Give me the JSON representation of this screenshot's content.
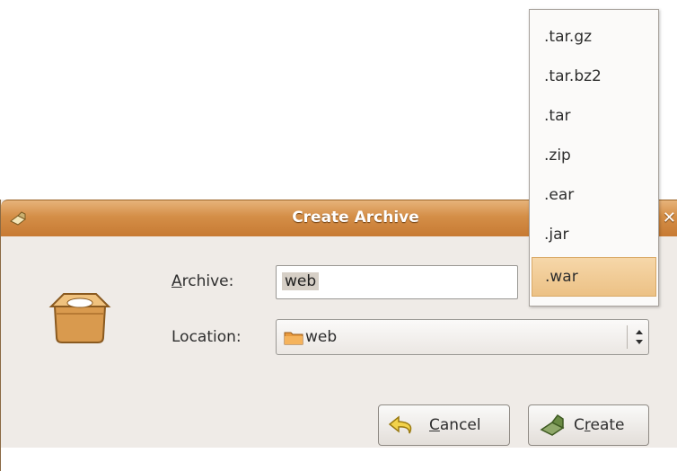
{
  "dialog": {
    "title": "Create Archive",
    "close_glyph": "✕",
    "archive_label_mnemonic": "A",
    "archive_label_rest": "rchive:",
    "archive_value": "web",
    "location_label": "Location:",
    "location_value": "web",
    "cancel_mnemonic": "C",
    "cancel_rest": "ancel",
    "create_prefix": "C",
    "create_mnemonic": "r",
    "create_rest": "eate",
    "accent_color": "#d48e47"
  },
  "menu": {
    "items": [
      ".tar.gz",
      ".tar.bz2",
      ".tar",
      ".zip",
      ".ear",
      ".jar",
      ".war"
    ],
    "selected": ".war"
  },
  "icons": {
    "title": "archive-manager-icon",
    "archive": "open-box-icon",
    "folder": "folder-icon",
    "cancel": "undo-arrow-icon",
    "create": "create-archive-icon"
  }
}
